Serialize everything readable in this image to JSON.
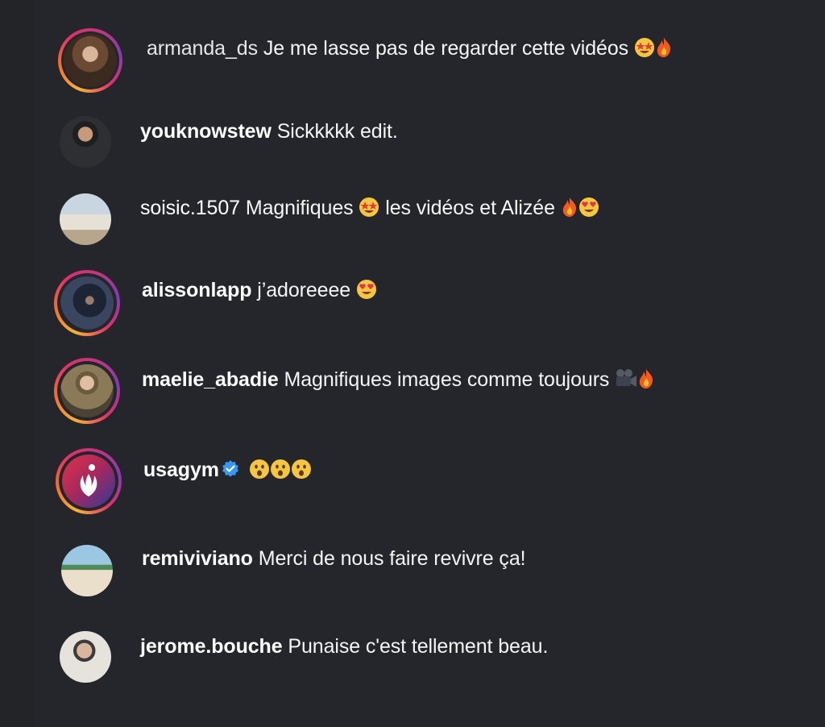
{
  "comments": [
    {
      "username": "armanda_ds",
      "text": "Je me lasse pas de regarder cette vidéos",
      "emojis": [
        "star-struck-emoji",
        "fire-emoji"
      ]
    },
    {
      "username": "youknowstew",
      "text": "Sickkkkk edit.",
      "emojis": []
    },
    {
      "username": "soisic.1507",
      "text": "Magnifiques",
      "text2": "les vidéos et Alizée",
      "emojis": [
        "star-struck-emoji",
        "fire-emoji",
        "heart-eyes-emoji"
      ]
    },
    {
      "username": "alissonlapp",
      "text": "j’adoreeee",
      "emojis": [
        "heart-eyes-emoji"
      ]
    },
    {
      "username": "maelie_abadie",
      "text": "Magnifiques images comme toujours",
      "emojis": [
        "movie-camera-emoji",
        "fire-emoji"
      ]
    },
    {
      "username": "usagym",
      "text": "",
      "verified": true,
      "emojis": [
        "astonished-emoji",
        "astonished-emoji",
        "astonished-emoji"
      ]
    },
    {
      "username": "remiviviano",
      "text": "Merci de nous faire revivre ça!",
      "emojis": []
    },
    {
      "username": "jerome.bouche",
      "text": "Punaise c'est tellement beau.",
      "emojis": []
    }
  ],
  "colors": {
    "background": "#25262b",
    "text": "#f5f5f5",
    "verified": "#3897f0",
    "story_ring": [
      "#f9b233",
      "#e1306c",
      "#833ab4"
    ]
  }
}
